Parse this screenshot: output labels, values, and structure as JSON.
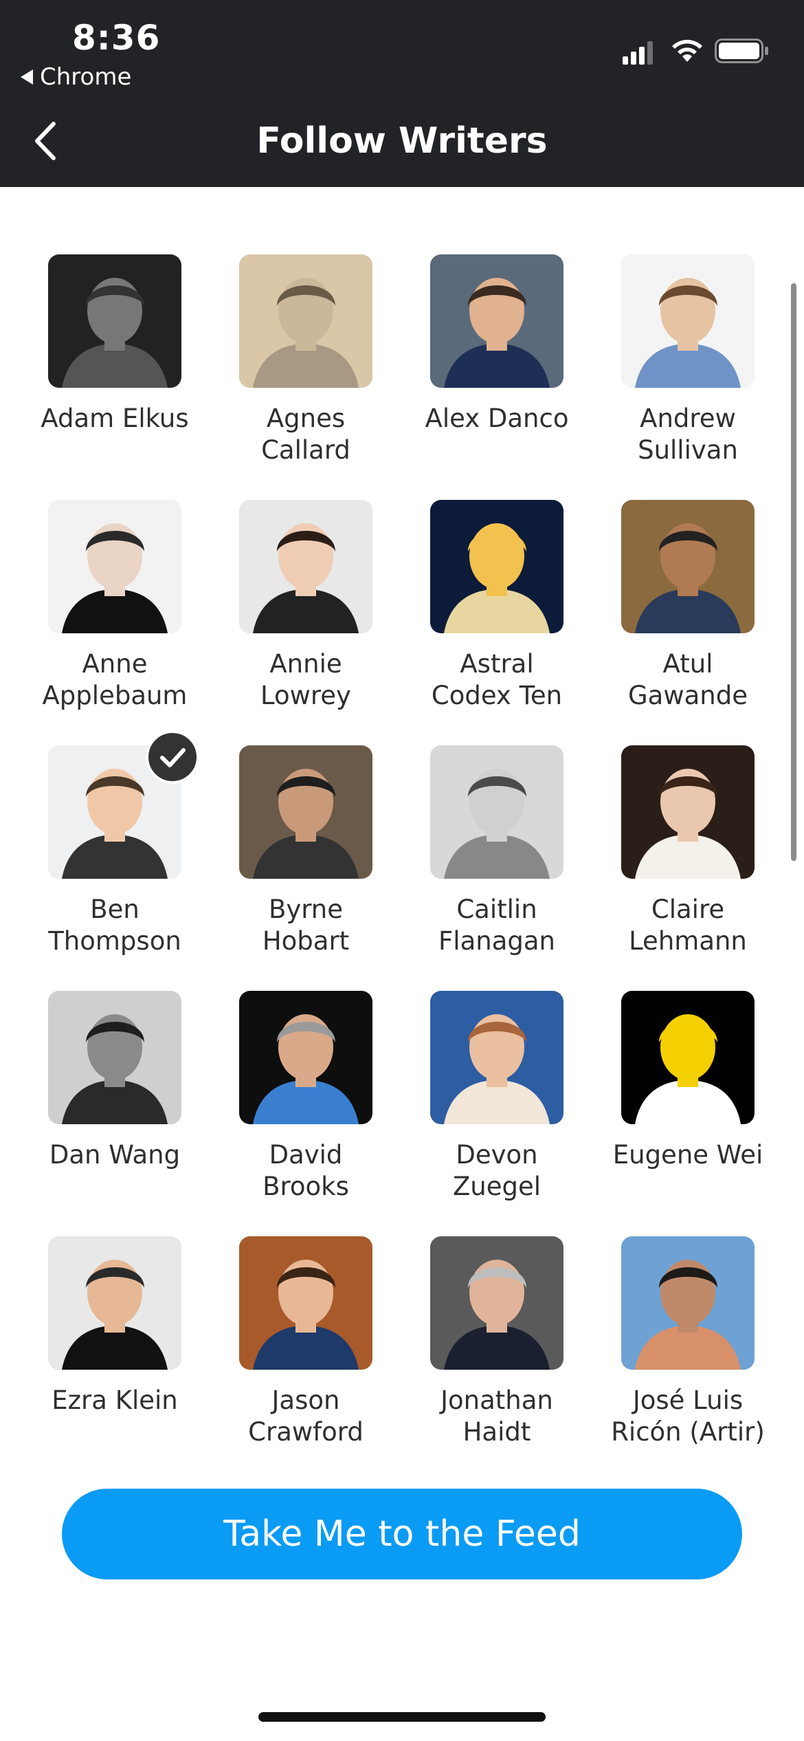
{
  "status_bar": {
    "time": "8:36",
    "back_app": "Chrome"
  },
  "header": {
    "title": "Follow Writers"
  },
  "writers": [
    {
      "name": "Adam Elkus",
      "selected": false
    },
    {
      "name": "Agnes\nCallard",
      "selected": false
    },
    {
      "name": "Alex Danco",
      "selected": false
    },
    {
      "name": "Andrew\nSullivan",
      "selected": false
    },
    {
      "name": "Anne\nApplebaum",
      "selected": false
    },
    {
      "name": "Annie\nLowrey",
      "selected": false
    },
    {
      "name": "Astral\nCodex Ten",
      "selected": false
    },
    {
      "name": "Atul\nGawande",
      "selected": false
    },
    {
      "name": "Ben\nThompson",
      "selected": true
    },
    {
      "name": "Byrne\nHobart",
      "selected": false
    },
    {
      "name": "Caitlin\nFlanagan",
      "selected": false
    },
    {
      "name": "Claire\nLehmann",
      "selected": false
    },
    {
      "name": "Dan Wang",
      "selected": false
    },
    {
      "name": "David\nBrooks",
      "selected": false
    },
    {
      "name": "Devon\nZuegel",
      "selected": false
    },
    {
      "name": "Eugene Wei",
      "selected": false
    },
    {
      "name": "Ezra Klein",
      "selected": false
    },
    {
      "name": "Jason\nCrawford",
      "selected": false
    },
    {
      "name": "Jonathan\nHaidt",
      "selected": false
    },
    {
      "name": "José Luis\nRicón (Artir)",
      "selected": false
    }
  ],
  "cta": {
    "label": "Take Me to the Feed"
  },
  "colors": {
    "header_bg": "#222326",
    "accent": "#0a9bf5",
    "check_bg": "#333333"
  },
  "icons": [
    "chevron-left-icon",
    "signal-icon",
    "wifi-icon",
    "battery-icon",
    "checkmark-icon"
  ]
}
